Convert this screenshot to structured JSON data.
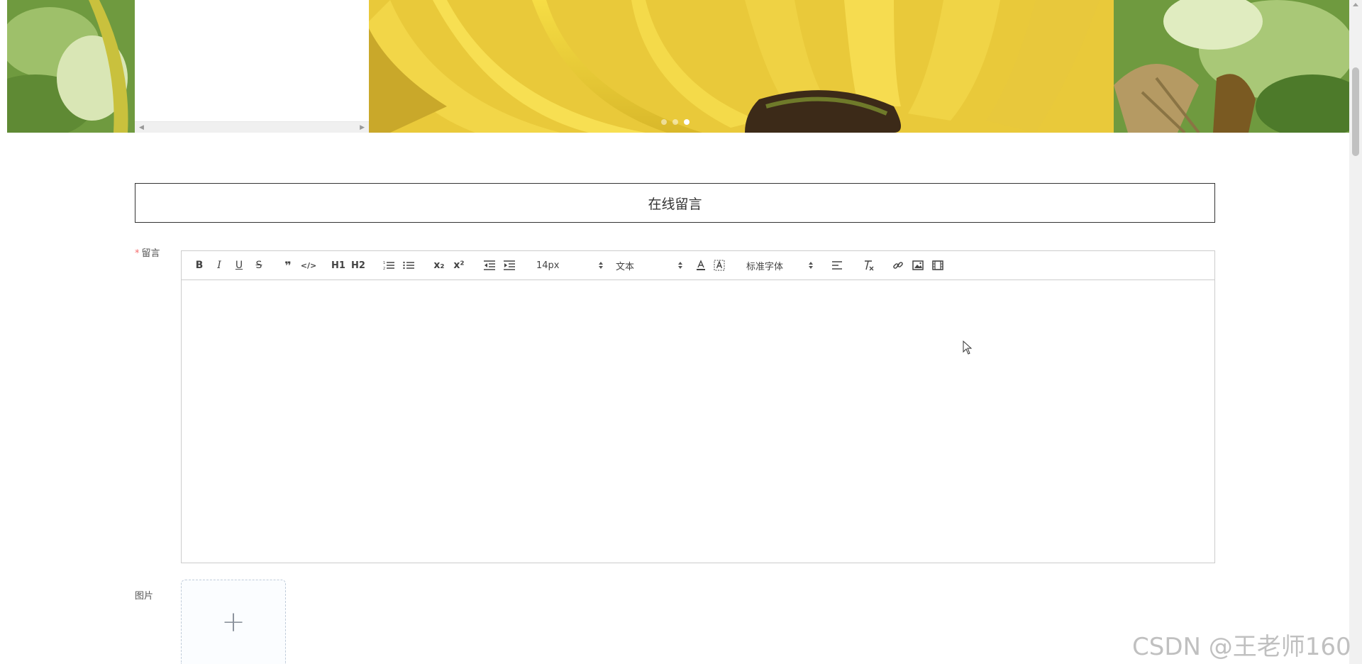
{
  "banner": {
    "slides": 3,
    "active_slide": 3
  },
  "form": {
    "title": "在线留言",
    "message_label": "留言",
    "required_mark": "*",
    "image_label": "图片",
    "upload_plus": "+"
  },
  "toolbar": {
    "bold": "B",
    "italic": "I",
    "underline": "U",
    "strike": "S",
    "blockquote": "❞",
    "code": "</>",
    "h1": "H1",
    "h2": "H2",
    "sub": "x₂",
    "sup": "x²",
    "size_value": "14px",
    "header_value": "文本",
    "font_value": "标准字体"
  },
  "watermark": "CSDN @王老师160",
  "colors": {
    "required": "#f56c6c",
    "border": "#cccccc",
    "upload_border": "#c0ccda"
  }
}
